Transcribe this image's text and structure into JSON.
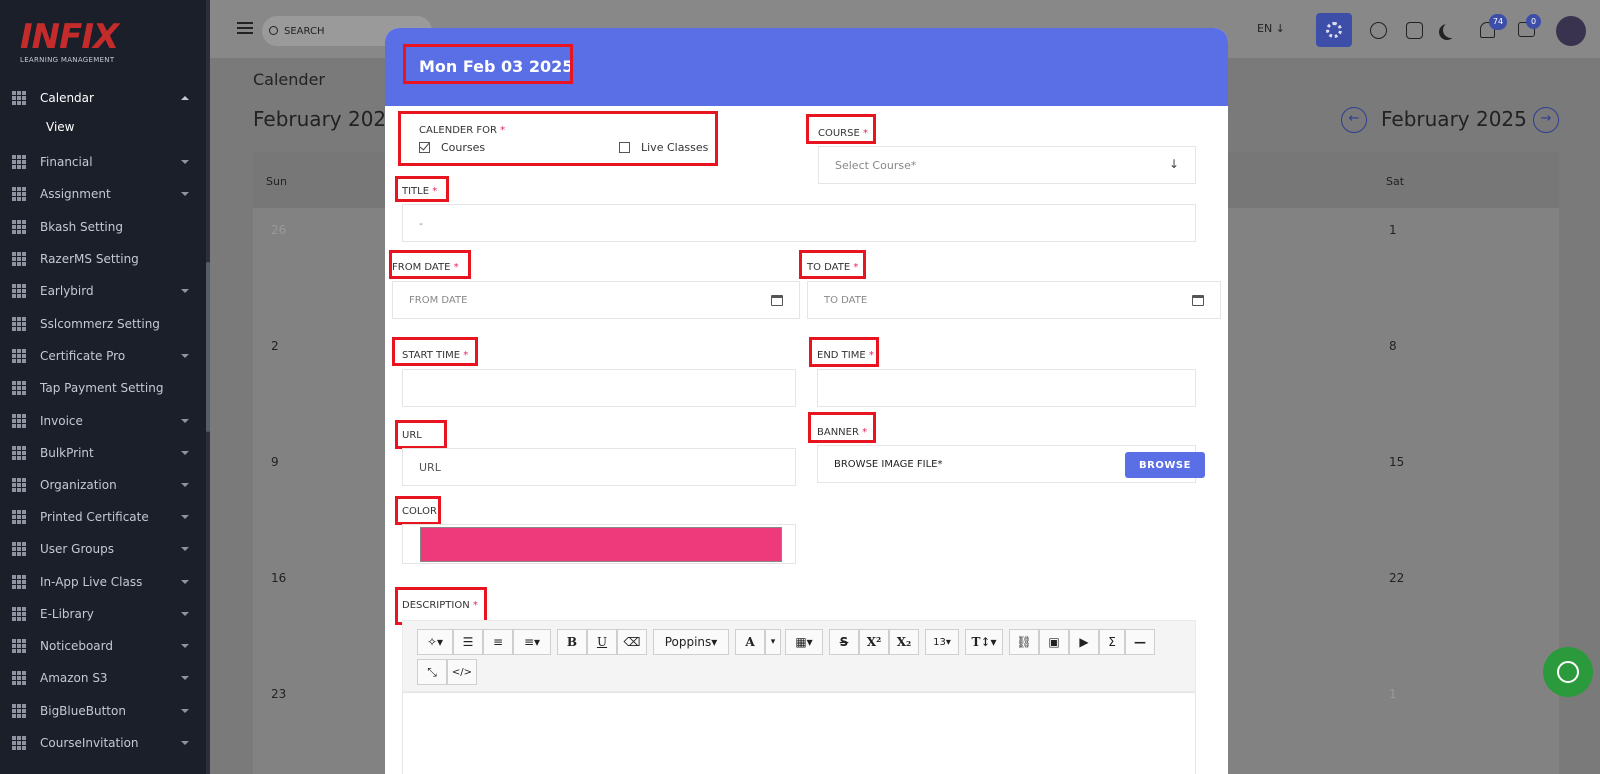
{
  "logo": {
    "text": "INFIX",
    "sub": "LEARNING MANAGEMENT"
  },
  "topbar": {
    "search_placeholder": "SEARCH",
    "language": "EN ↓",
    "notifications": "74",
    "messages": "0"
  },
  "sidebar": {
    "items": [
      {
        "label": "Calendar",
        "expanded": true
      },
      {
        "label": "Financial"
      },
      {
        "label": "Assignment"
      },
      {
        "label": "Bkash Setting"
      },
      {
        "label": "RazerMS Setting"
      },
      {
        "label": "Earlybird"
      },
      {
        "label": "Sslcommerz Setting"
      },
      {
        "label": "Certificate Pro"
      },
      {
        "label": "Tap Payment Setting"
      },
      {
        "label": "Invoice"
      },
      {
        "label": "BulkPrint"
      },
      {
        "label": "Organization"
      },
      {
        "label": "Printed Certificate"
      },
      {
        "label": "User Groups"
      },
      {
        "label": "In-App Live Class"
      },
      {
        "label": "E-Library"
      },
      {
        "label": "Noticeboard"
      },
      {
        "label": "Amazon S3"
      },
      {
        "label": "BigBlueButton"
      },
      {
        "label": "CourseInvitation"
      }
    ],
    "sub_item": "View"
  },
  "calendar": {
    "page_title": "Calender",
    "month": "February 2025",
    "days": [
      "Sun",
      "Sat"
    ],
    "dates": [
      "26",
      "1",
      "2",
      "8",
      "9",
      "15",
      "16",
      "22",
      "23",
      "1"
    ]
  },
  "modal": {
    "title": "Mon Feb 03 2025",
    "calendar_for_label": "CALENDER FOR",
    "opt_courses": "Courses",
    "opt_live": "Live Classes",
    "course_label": "COURSE",
    "course_select": "Select Course*",
    "title_label": "TITLE",
    "title_value": "-",
    "from_date_label": "FROM DATE",
    "from_date_placeholder": "FROM DATE",
    "to_date_label": "TO DATE",
    "to_date_placeholder": "TO DATE",
    "start_time_label": "START TIME",
    "end_time_label": "END TIME",
    "url_label": "URL",
    "url_placeholder": "URL",
    "banner_label": "BANNER",
    "banner_placeholder": "BROWSE IMAGE FILE*",
    "browse_button": "BROWSE",
    "color_label": "COLOR",
    "color_value": "#ee3a7b",
    "description_label": "DESCRIPTION",
    "required_mark": "*",
    "toolbar": {
      "font": "Poppins",
      "font_size": "13",
      "code": "</>"
    }
  }
}
